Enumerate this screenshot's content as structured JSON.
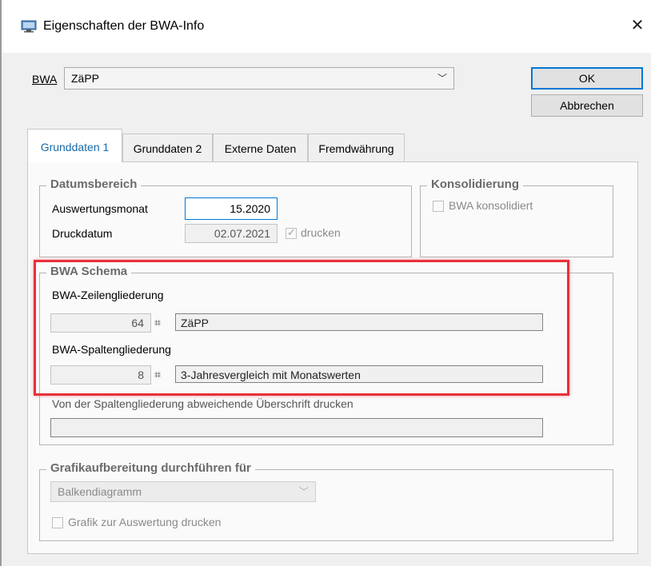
{
  "window": {
    "title": "Eigenschaften der BWA-Info",
    "close_glyph": "✕"
  },
  "bwa": {
    "label": "BWA",
    "selected": "ZäPP",
    "ok_label": "OK",
    "cancel_label": "Abbrechen"
  },
  "tabs": [
    {
      "label": "Grunddaten 1",
      "active": true
    },
    {
      "label": "Grunddaten 2",
      "active": false
    },
    {
      "label": "Externe Daten",
      "active": false
    },
    {
      "label": "Fremdwährung",
      "active": false
    }
  ],
  "datumsbereich": {
    "title": "Datumsbereich",
    "auswertungsmonat_label": "Auswertungsmonat",
    "auswertungsmonat_value": "15.2020",
    "druckdatum_label": "Druckdatum",
    "druckdatum_value": "02.07.2021",
    "drucken_label": "drucken",
    "drucken_checked": true
  },
  "konsolidierung": {
    "title": "Konsolidierung",
    "checkbox_label": "BWA konsolidiert",
    "checked": false
  },
  "bwa_schema": {
    "title": "BWA Schema",
    "zeilen_label": "BWA-Zeilengliederung",
    "zeilen_number": "64",
    "zeilen_name": "ZäPP",
    "spalten_label": "BWA-Spaltengliederung",
    "spalten_number": "8",
    "spalten_name": "3-Jahresvergleich mit Monatswerten",
    "ueberschrift_label": "Von der Spaltengliederung abweichende Überschrift drucken",
    "ueberschrift_value": ""
  },
  "grafik": {
    "title": "Grafikaufbereitung durchführen für",
    "diagram_type": "Balkendiagramm",
    "print_label": "Grafik zur Auswertung drucken",
    "print_checked": false
  },
  "icons": {
    "binocular": "binocular-icon",
    "dropdown": "chevron-down-icon",
    "window": "window-icon"
  },
  "colors": {
    "highlight": "#e8303a",
    "accent": "#0078d7"
  }
}
